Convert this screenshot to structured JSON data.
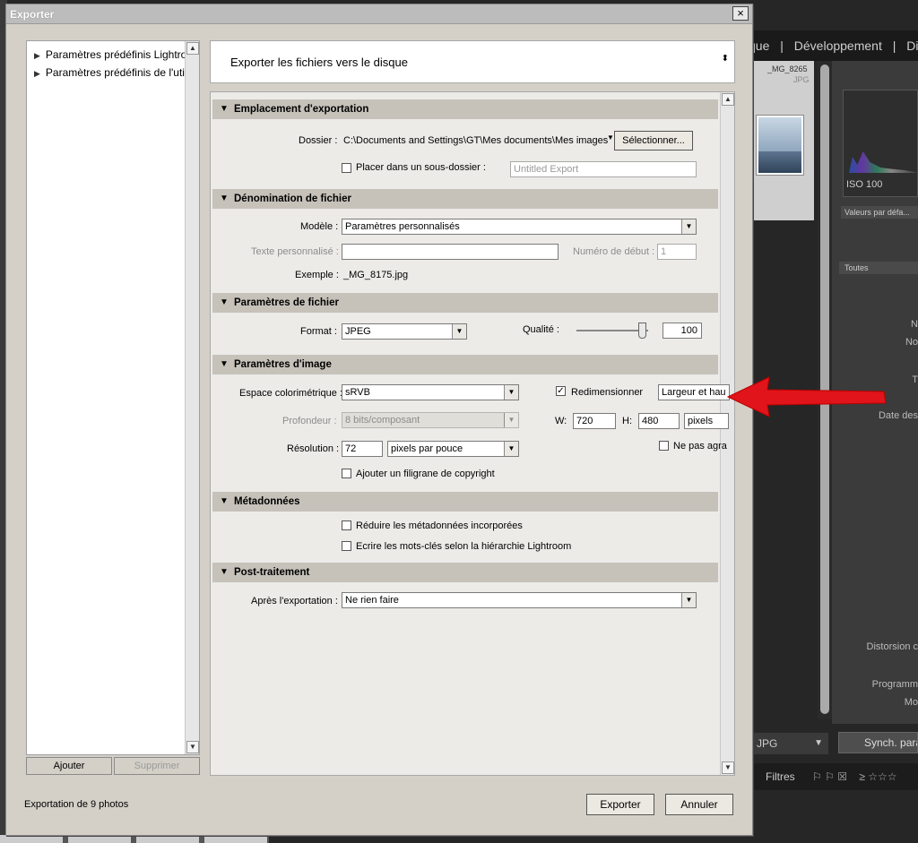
{
  "lightroom": {
    "top_nav": [
      "que",
      "|",
      "Développement",
      "|",
      "Dia"
    ],
    "thumb_name": "_MG_8265",
    "thumb_type": "JPG",
    "iso": "ISO 100",
    "valeurs": "Valeurs par défa...",
    "toutes": "Toutes",
    "meta_labels": [
      "N",
      "No",
      "T",
      "Date des",
      "Distorsion c",
      "Programm",
      "Mo"
    ],
    "jpg": "JPG",
    "synch": "Synch. para",
    "filtres": "Filtres"
  },
  "dialog": {
    "title": "Exporter",
    "close": "×",
    "presets": [
      "Paramètres prédéfinis Lightroom",
      "Paramètres prédéfinis de l'utilisateur"
    ],
    "add_button": "Ajouter",
    "remove_button": "Supprimer",
    "destination": "Exporter les fichiers vers le disque",
    "sections": {
      "location": {
        "header": "Emplacement d'exportation",
        "folder_label": "Dossier :",
        "folder_value": "C:\\Documents and Settings\\GT\\Mes documents\\Mes images",
        "select_button": "Sélectionner...",
        "subfolder_label": "Placer dans un sous-dossier :",
        "subfolder_value": "Untitled Export"
      },
      "naming": {
        "header": "Dénomination de fichier",
        "template_label": "Modèle :",
        "template_value": "Paramètres personnalisés",
        "custom_text_label": "Texte personnalisé :",
        "custom_text_value": "",
        "start_number_label": "Numéro de début :",
        "start_number_value": "1",
        "example_label": "Exemple :",
        "example_value": "_MG_8175.jpg"
      },
      "file": {
        "header": "Paramètres de fichier",
        "format_label": "Format :",
        "format_value": "JPEG",
        "quality_label": "Qualité :",
        "quality_value": "100",
        "quality_level": 100
      },
      "image": {
        "header": "Paramètres d'image",
        "color_space_label": "Espace colorimétrique :",
        "color_space_value": "sRVB",
        "depth_label": "Profondeur :",
        "depth_value": "8 bits/composant",
        "resolution_label": "Résolution :",
        "resolution_value": "72",
        "resolution_unit": "pixels par pouce",
        "resize_label": "Redimensionner",
        "resize_checked": true,
        "resize_mode": "Largeur et hau",
        "w_label": "W:",
        "w_value": "720",
        "h_label": "H:",
        "h_value": "480",
        "unit_value": "pixels",
        "no_enlarge_label": "Ne pas agra",
        "watermark_label": "Ajouter un filigrane de copyright"
      },
      "metadata": {
        "header": "Métadonnées",
        "minimize_label": "Réduire les métadonnées incorporées",
        "keywords_label": "Ecrire les mots-clés selon la hiérarchie Lightroom"
      },
      "post": {
        "header": "Post-traitement",
        "after_label": "Après l'exportation :",
        "after_value": "Ne rien faire"
      }
    },
    "export_count": "Exportation de 9 photos",
    "export_button": "Exporter",
    "cancel_button": "Annuler"
  },
  "colors": {
    "dialog_bg": "#d4d0c8",
    "section_header": "#c6c2ba",
    "annotation_arrow": "#e0141a"
  }
}
